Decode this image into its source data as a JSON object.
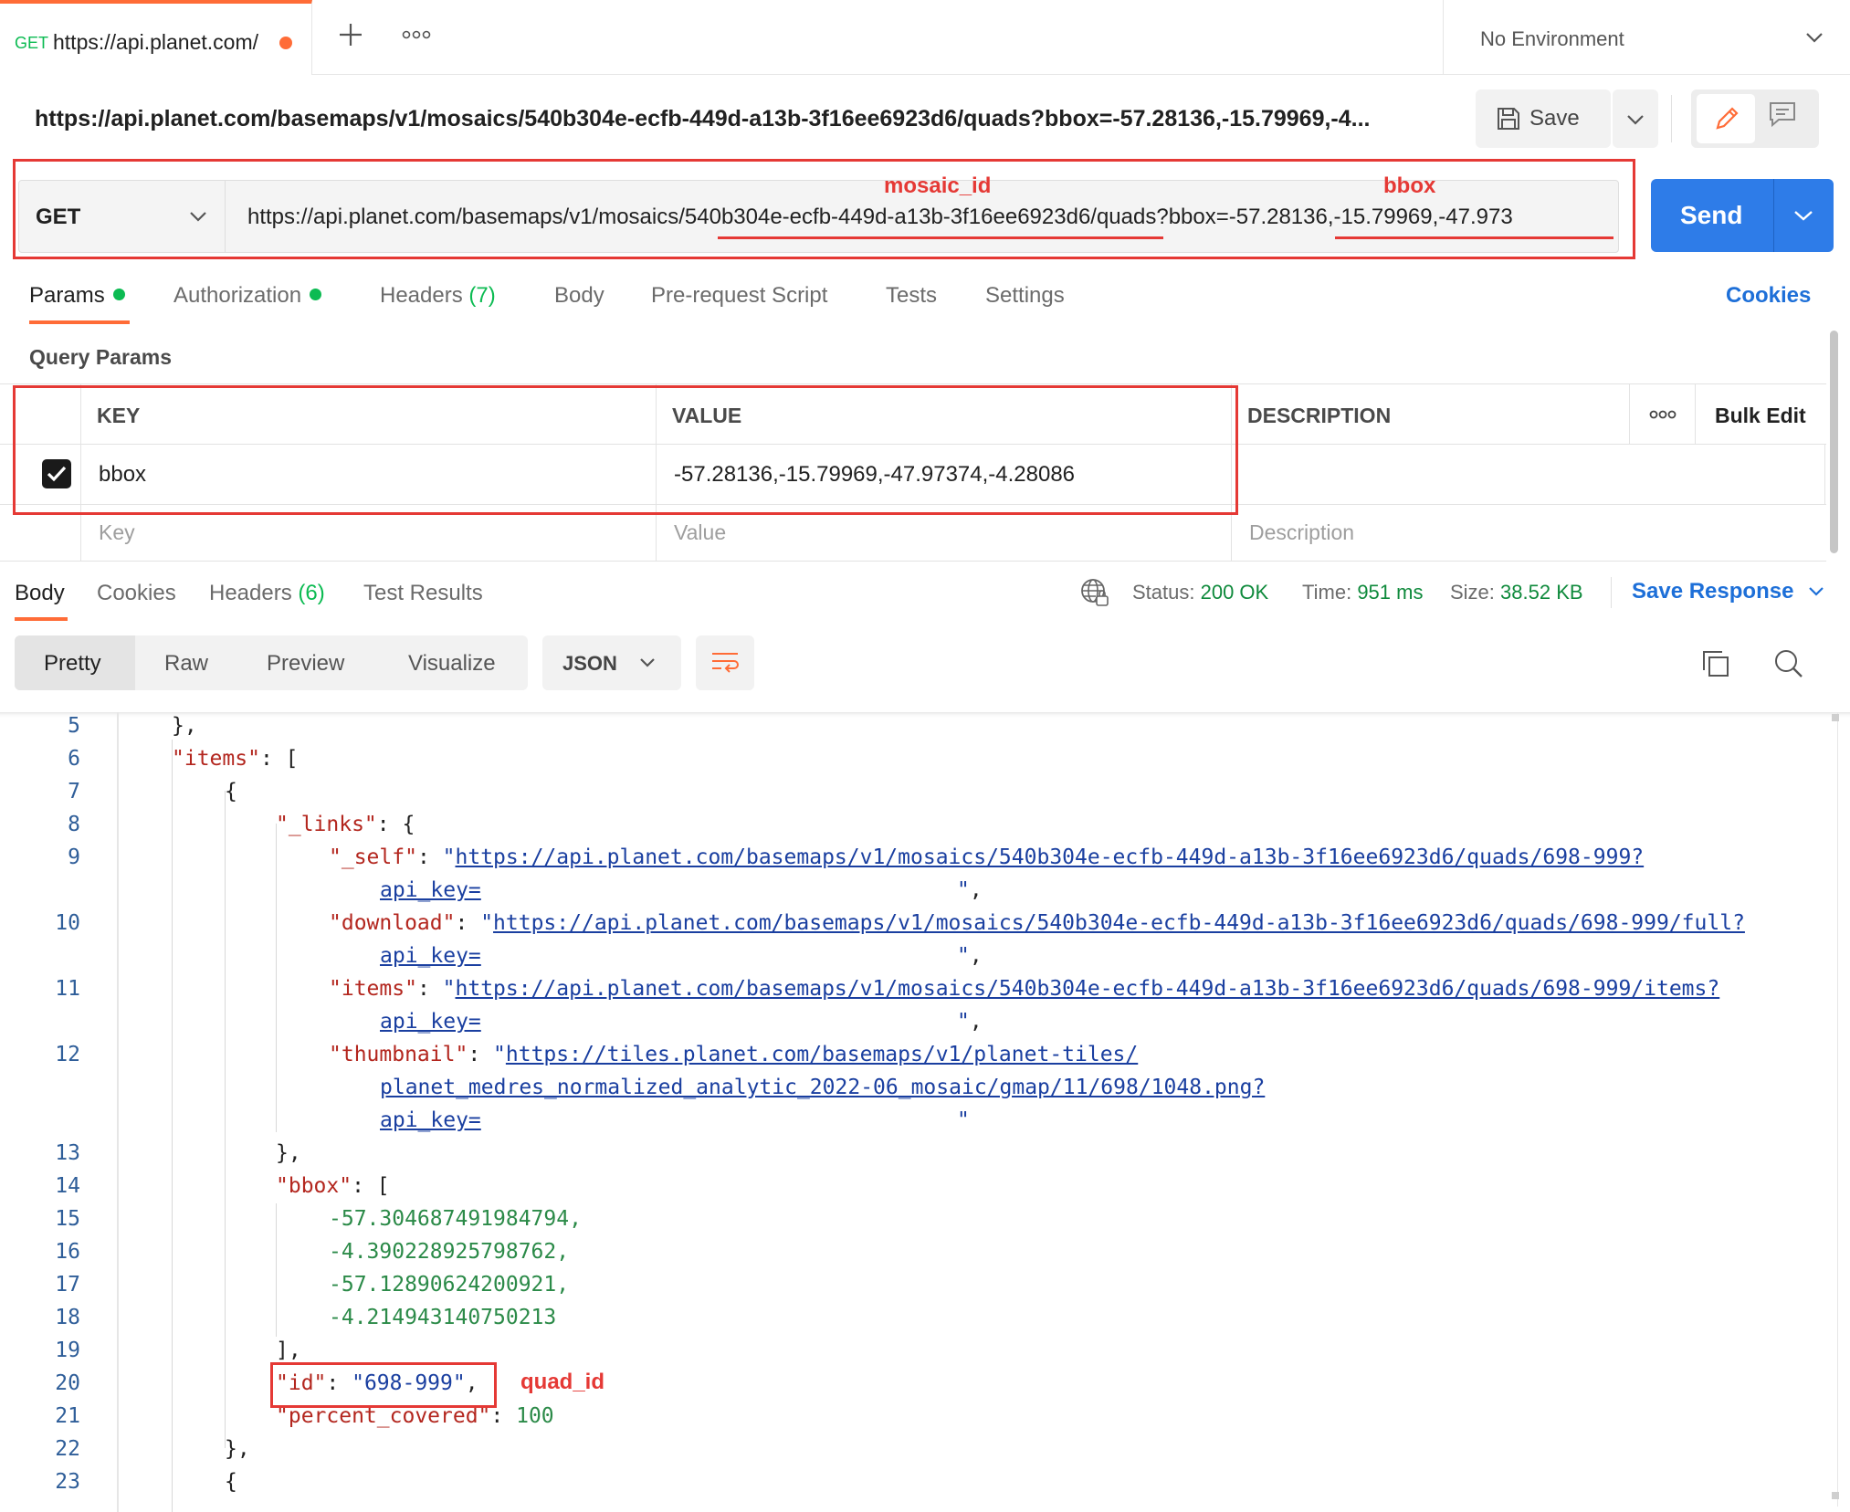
{
  "tab": {
    "method": "GET",
    "url": "https://api.planet.com/"
  },
  "environment": "No Environment",
  "header_url": "https://api.planet.com/basemaps/v1/mosaics/540b304e-ecfb-449d-a13b-3f16ee6923d6/quads?bbox=-57.28136,-15.79969,-4...",
  "toolbar": {
    "save_label": "Save"
  },
  "request": {
    "method": "GET",
    "url": "https://api.planet.com/basemaps/v1/mosaics/540b304e-ecfb-449d-a13b-3f16ee6923d6/quads?bbox=-57.28136,-15.79969,-47.973",
    "send_label": "Send"
  },
  "annotations": {
    "mosaic_id": "mosaic_id",
    "bbox": "bbox",
    "quad_id": "quad_id"
  },
  "param_tabs": {
    "params": "Params",
    "authorization": "Authorization",
    "headers": "Headers",
    "headers_count": "(7)",
    "body": "Body",
    "prerequest": "Pre-request Script",
    "tests": "Tests",
    "settings": "Settings",
    "cookies": "Cookies"
  },
  "query_params": {
    "title": "Query Params",
    "headers": {
      "key": "KEY",
      "value": "VALUE",
      "description": "DESCRIPTION",
      "bulk_edit": "Bulk Edit"
    },
    "rows": [
      {
        "key": "bbox",
        "value": "-57.28136,-15.79969,-47.97374,-4.28086",
        "description": "",
        "checked": true
      }
    ],
    "placeholders": {
      "key": "Key",
      "value": "Value",
      "description": "Description"
    }
  },
  "response": {
    "tabs": {
      "body": "Body",
      "cookies": "Cookies",
      "headers": "Headers",
      "headers_count": "(6)",
      "test_results": "Test Results"
    },
    "status_label": "Status:",
    "status": "200 OK",
    "time_label": "Time:",
    "time": "951 ms",
    "size_label": "Size:",
    "size": "38.52 KB",
    "save_response": "Save Response",
    "modes": {
      "pretty": "Pretty",
      "raw": "Raw",
      "preview": "Preview",
      "visualize": "Visualize"
    },
    "format": "JSON"
  },
  "code": {
    "line_numbers": [
      "5",
      "6",
      "7",
      "8",
      "9",
      "10",
      "11",
      "12",
      "13",
      "14",
      "15",
      "16",
      "17",
      "18",
      "19",
      "20",
      "21",
      "22",
      "23"
    ],
    "items_key": "\"items\"",
    "links_key": "\"_links\"",
    "self_key": "\"_self\"",
    "self_url": "https://api.planet.com/basemaps/v1/mosaics/540b304e-ecfb-449d-a13b-3f16ee6923d6/quads/698-999?",
    "download_key": "\"download\"",
    "download_url": "https://api.planet.com/basemaps/v1/mosaics/540b304e-ecfb-449d-a13b-3f16ee6923d6/quads/698-999/full?",
    "items_link_key": "\"items\"",
    "items_url": "https://api.planet.com/basemaps/v1/mosaics/540b304e-ecfb-449d-a13b-3f16ee6923d6/quads/698-999/items?",
    "thumbnail_key": "\"thumbnail\"",
    "thumbnail_url_1": "https://tiles.planet.com/basemaps/v1/planet-tiles/",
    "thumbnail_url_2": "planet_medres_normalized_analytic_2022-06_mosaic/gmap/11/698/1048.png?",
    "api_key": "api_key=",
    "bbox_key": "\"bbox\"",
    "bbox_values": [
      "-57.304687491984794,",
      "-4.390228925798762,",
      "-57.12890624200921,",
      "-4.214943140750213"
    ],
    "id_key": "\"id\"",
    "id_value": "\"698-999\"",
    "percent_key": "\"percent_covered\"",
    "percent_value": "100"
  }
}
